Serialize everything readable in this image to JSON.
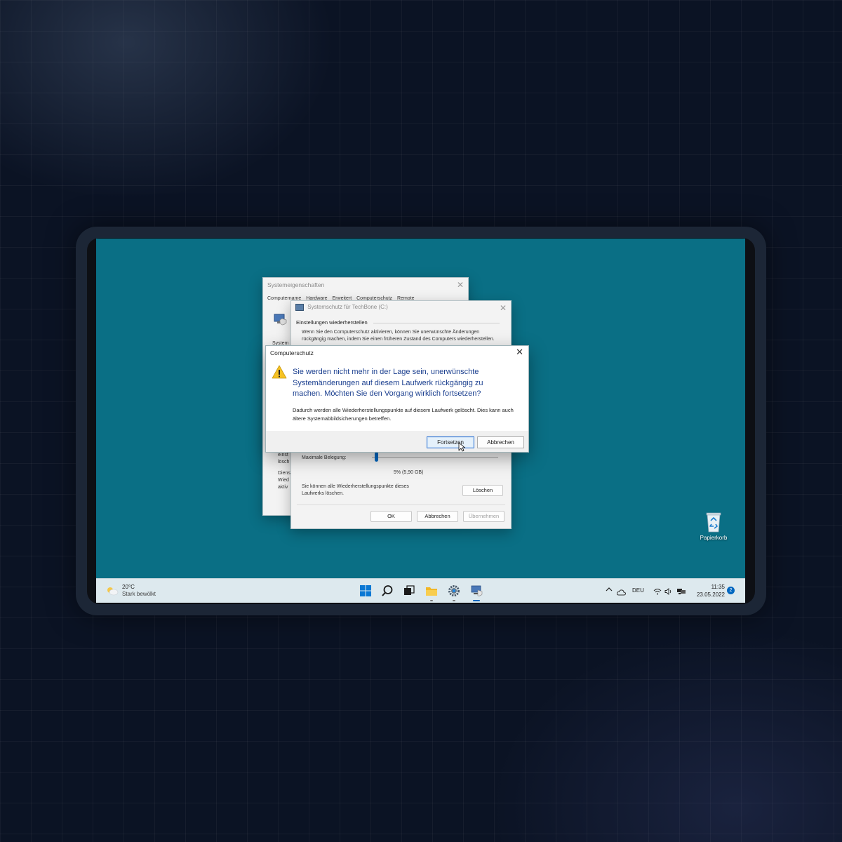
{
  "systemprops": {
    "title": "Systemeigenschaften",
    "tabs": [
      "Computername",
      "Hardware",
      "Erweitert",
      "Computerschutz",
      "Remote"
    ],
    "frag_system": "System",
    "frag_einst": "einst",
    "frag_losch": "lösch",
    "frag_dienst": "Dienst",
    "frag_wied": "Wied",
    "frag_aktiv": "aktiv"
  },
  "sysschutz": {
    "title": "Systemschutz für TechBone (C:)",
    "section": "Einstellungen wiederherstellen",
    "desc": "Wenn Sie den Computerschutz aktivieren, können Sie unerwünschte Änderungen rückgängig machen, indem Sie einen früheren Zustand des Computers wiederherstellen.",
    "max_label": "Maximale Belegung:",
    "usage_value": "5% (5,90 GB)",
    "usage_fraction": 0.05,
    "delete_text": "Sie können alle Wiederherstellungspunkte dieses Laufwerks löschen.",
    "delete_btn": "Löschen",
    "ok_btn": "OK",
    "cancel_btn": "Abbrechen",
    "apply_btn": "Übernehmen"
  },
  "dialog": {
    "title": "Computerschutz",
    "main_text": "Sie werden nicht mehr in der Lage sein, unerwünschte Systemänderungen auf diesem Laufwerk rückgängig zu machen. Möchten Sie den Vorgang wirklich fortsetzen?",
    "sub_text": "Dadurch werden alle Wiederherstellungspunkte auf diesem Laufwerk gelöscht. Dies kann auch ältere Systemabbildsicherungen betreffen.",
    "continue_btn": "Fortsetzen",
    "cancel_btn": "Abbrechen"
  },
  "desktop": {
    "recycle_label": "Papierkorb"
  },
  "taskbar": {
    "weather_temp": "20°C",
    "weather_desc": "Stark bewölkt",
    "lang": "DEU",
    "time": "11:35",
    "date": "23.05.2022",
    "notif_count": "2"
  },
  "colors": {
    "desktop": "#0a6f85",
    "accent": "#0067c0",
    "dialog_text": "#1b3f8f"
  }
}
